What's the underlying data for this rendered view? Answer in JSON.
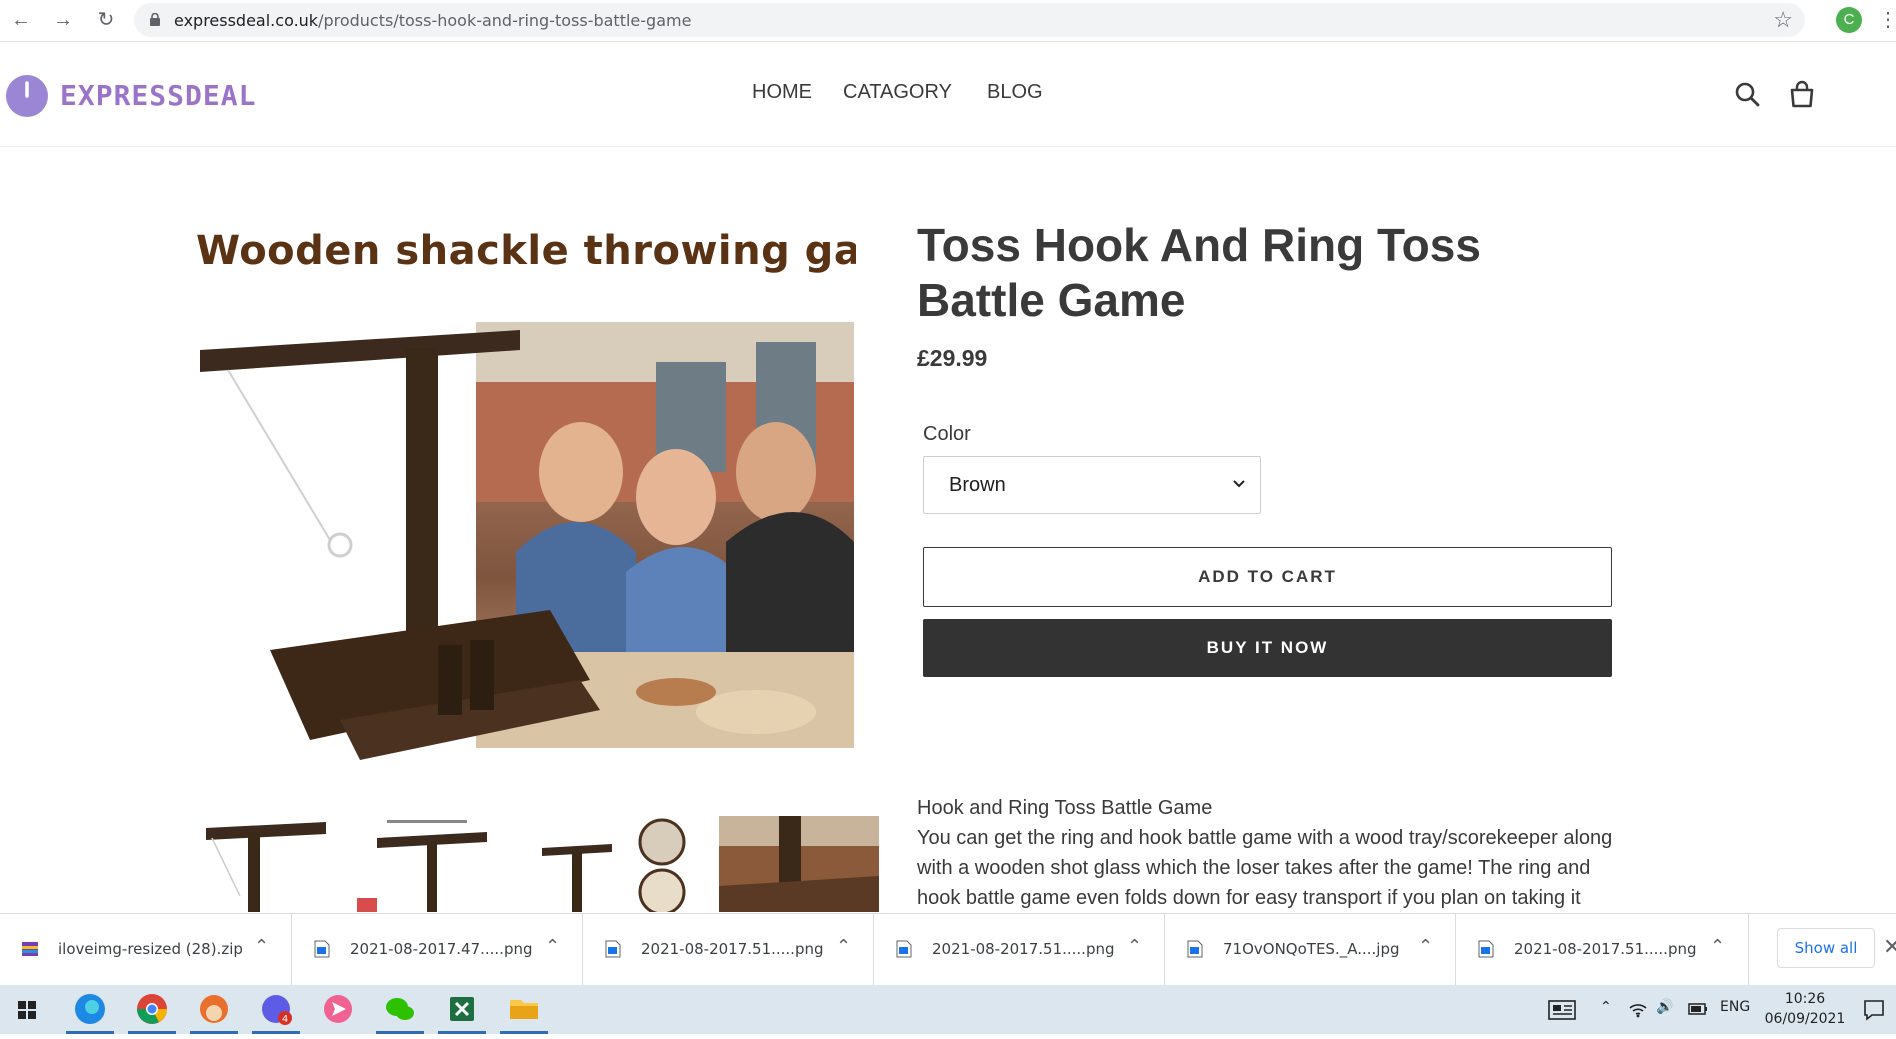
{
  "browser": {
    "url_host": "expressdeal.co.uk",
    "url_path": "/products/toss-hook-and-ring-toss-battle-game",
    "profile_initial": "C"
  },
  "header": {
    "logo_text": "EXPRESSDEAL",
    "nav": [
      "HOME",
      "CATAGORY",
      "BLOG"
    ]
  },
  "product": {
    "image_caption": "Wooden shackle throwing game",
    "title": "Toss Hook And Ring Toss Battle Game",
    "price": "£29.99",
    "option_label": "Color",
    "option_value": "Brown",
    "add_to_cart": "ADD TO CART",
    "buy_now": "BUY IT NOW",
    "description_heading": "Hook and Ring Toss Battle Game",
    "description_body": "You can get the ring and hook battle game with a wood tray/scorekeeper along with a wooden shot glass which the loser takes after the game! The ring and hook battle game even folds down for easy transport if you plan on taking it"
  },
  "downloads": {
    "items": [
      "iloveimg-resized (28).zip",
      "2021-08-2017.47.....png",
      "2021-08-2017.51.....png",
      "2021-08-2017.51.....png",
      "71OvONQoTES._A....jpg",
      "2021-08-2017.51.....png"
    ],
    "show_all": "Show all"
  },
  "taskbar": {
    "lang": "ENG",
    "time": "10:26",
    "date": "06/09/2021",
    "badge": "4"
  },
  "colors": {
    "accent_purple": "#9b74c9",
    "button_dark": "#333333",
    "link_blue": "#1a73e8"
  }
}
